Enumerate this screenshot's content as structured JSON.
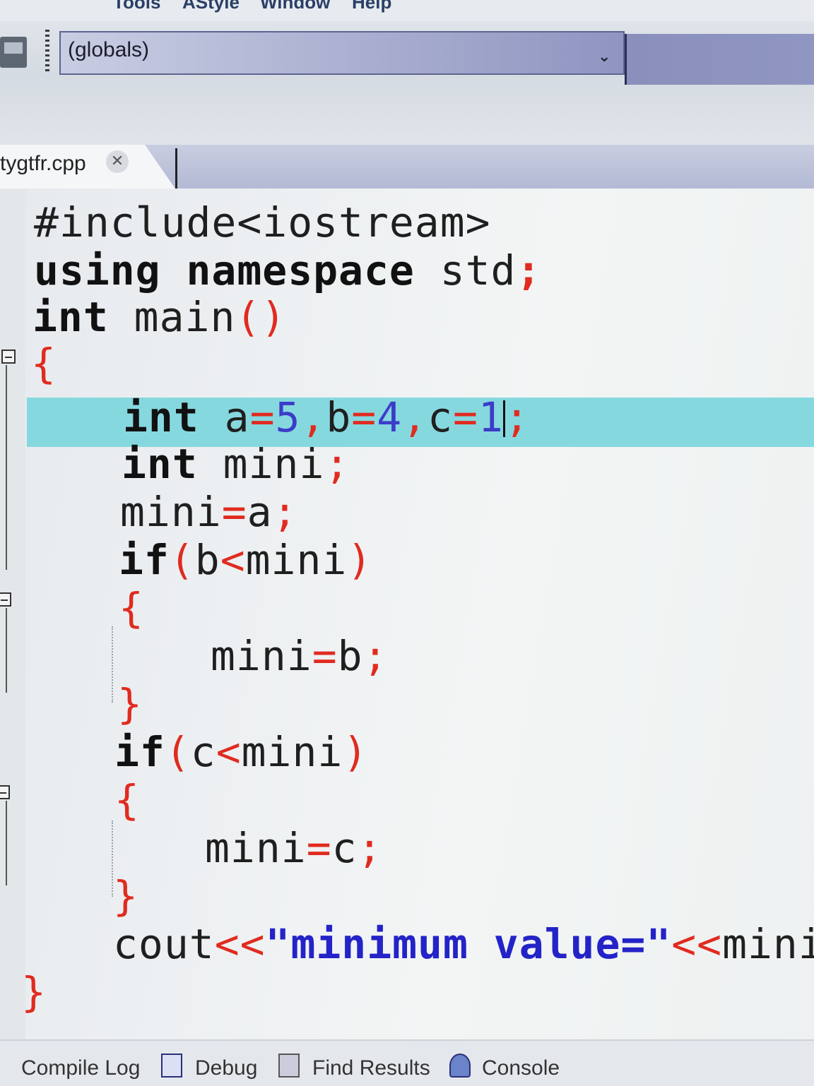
{
  "menu": {
    "items": [
      "Tools",
      "AStyle",
      "Window",
      "Help"
    ]
  },
  "toolbar": {
    "scope_combo_value": "(globals)"
  },
  "editor": {
    "tab_title": "tygtfr.cpp",
    "code_lines": [
      "#include<iostream>",
      "using namespace std;",
      "int main()",
      "{",
      "int a=5,b=4,c=1;",
      "int mini;",
      "mini=a;",
      "if(b<mini)",
      "{",
      "mini=b;",
      "}",
      "if(c<mini)",
      "{",
      "mini=c;",
      "}",
      "cout<<\"minimum value=\"<<mini;",
      "}"
    ]
  },
  "bottom_tabs": [
    "Compile Log",
    "Debug",
    "Find Results",
    "Console"
  ],
  "colors": {
    "current_line_highlight": "#86d8df",
    "operator_red": "#e02b1f",
    "number_blue": "#3c3cc9",
    "string_blue": "#2323c8"
  }
}
